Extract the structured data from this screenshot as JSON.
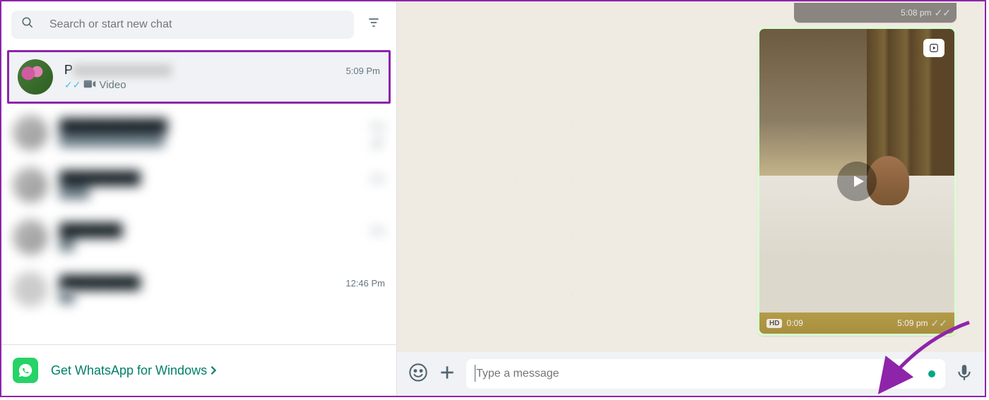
{
  "sidebar": {
    "search_placeholder": "Search or start new chat",
    "chats": [
      {
        "name_initial": "P",
        "time": "5:09 Pm",
        "subtitle": "Video",
        "selected": true
      },
      {
        "name_initial": "",
        "time": "Pm",
        "subtitle": "",
        "muted": true
      },
      {
        "name_initial": "",
        "time": "Pm",
        "subtitle": ""
      },
      {
        "name_initial": "",
        "time": "Pm",
        "subtitle": ""
      },
      {
        "name_initial": "",
        "time": "12:46 Pm",
        "subtitle": ""
      }
    ],
    "promo": "Get WhatsApp for Windows"
  },
  "chat": {
    "older_msg_time": "5:08 pm",
    "video_duration": "0:09",
    "video_time": "5:09 pm",
    "hd_label": "HD",
    "input_placeholder": "Type a message"
  }
}
